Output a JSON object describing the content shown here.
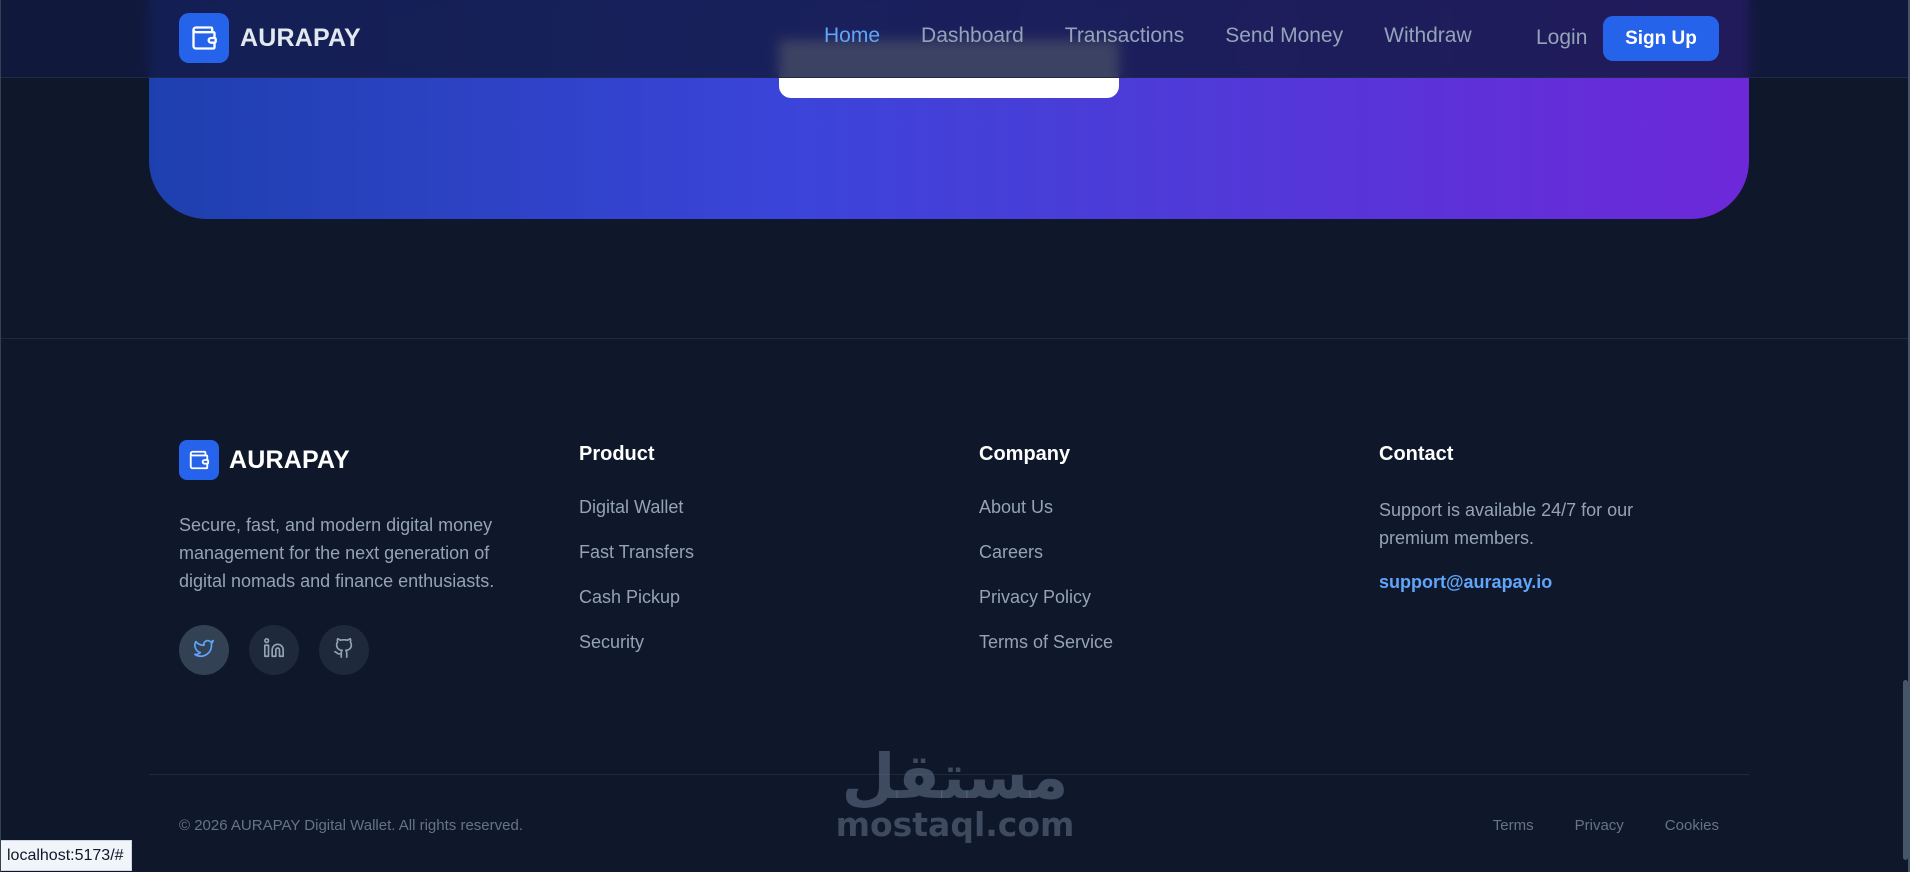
{
  "navbar": {
    "brand": "AURAPAY",
    "links": [
      {
        "label": "Home",
        "active": true
      },
      {
        "label": "Dashboard",
        "active": false
      },
      {
        "label": "Transactions",
        "active": false
      },
      {
        "label": "Send Money",
        "active": false
      },
      {
        "label": "Withdraw",
        "active": false
      }
    ],
    "login_label": "Login",
    "signup_label": "Sign Up"
  },
  "footer": {
    "brand": "AURAPAY",
    "description": "Secure, fast, and modern digital money management for the next generation of digital nomads and finance enthusiasts.",
    "socials": [
      {
        "icon": "twitter-icon"
      },
      {
        "icon": "linkedin-icon"
      },
      {
        "icon": "github-icon"
      }
    ],
    "product": {
      "title": "Product",
      "links": [
        "Digital Wallet",
        "Fast Transfers",
        "Cash Pickup",
        "Security"
      ]
    },
    "company": {
      "title": "Company",
      "links": [
        "About Us",
        "Careers",
        "Privacy Policy",
        "Terms of Service"
      ]
    },
    "contact": {
      "title": "Contact",
      "text": "Support is available 24/7 for our premium members.",
      "email": "support@aurapay.io"
    },
    "copyright": "© 2026 AURAPAY Digital Wallet. All rights reserved.",
    "legal_links": [
      "Terms",
      "Privacy",
      "Cookies"
    ]
  },
  "watermark": {
    "arabic": "مستقل",
    "latin": "mostaql.com"
  },
  "status_bar": {
    "url": "localhost:5173/#"
  },
  "colors": {
    "background": "#0f172a",
    "accent": "#2563eb",
    "link_active": "#60a5fa",
    "gradient_start": "#1e40af",
    "gradient_end": "#6d28d9"
  }
}
